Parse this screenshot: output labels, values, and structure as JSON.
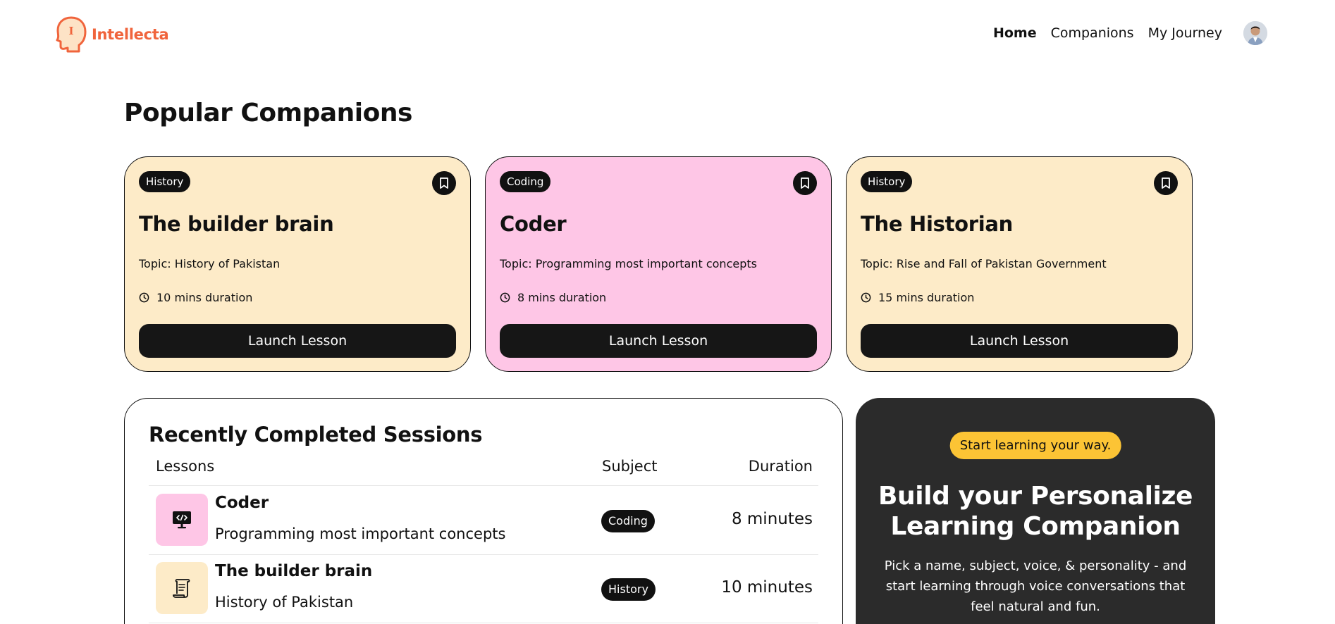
{
  "nav": {
    "brand": "Intellecta",
    "logo_letter": "I",
    "links": [
      "Home",
      "Companions",
      "My Journey"
    ],
    "active": "Home"
  },
  "popular": {
    "title": "Popular Companions",
    "cards": [
      {
        "subject": "History",
        "name": "The builder brain",
        "topic": "Topic: History of Pakistan",
        "duration": "10 mins duration",
        "button": "Launch Lesson",
        "color": "#fdebc8"
      },
      {
        "subject": "Coding",
        "name": "Coder",
        "topic": "Topic: Programming most important concepts",
        "duration": "8 mins duration",
        "button": "Launch Lesson",
        "color": "#fec6e6"
      },
      {
        "subject": "History",
        "name": "The Historian",
        "topic": "Topic: Rise and Fall of Pakistan Government",
        "duration": "15 mins duration",
        "button": "Launch Lesson",
        "color": "#fdebc8"
      }
    ]
  },
  "sessions": {
    "title": "Recently Completed Sessions",
    "columns": [
      "Lessons",
      "Subject",
      "Duration"
    ],
    "rows": [
      {
        "name": "Coder",
        "topic": "Programming most important concepts",
        "subject": "Coding",
        "duration": "8 minutes",
        "icon": "code-monitor-icon",
        "color": "#fec6e6"
      },
      {
        "name": "The builder brain",
        "topic": "History of Pakistan",
        "subject": "History",
        "duration": "10 minutes",
        "icon": "scroll-icon",
        "color": "#fdebc8"
      }
    ]
  },
  "cta": {
    "pill": "Start learning your way.",
    "title": "Build your Personalize Learning Companion",
    "description": "Pick a name, subject, voice, & personality - and start learning through voice conversations that feel natural and fun."
  },
  "colors": {
    "accent": "#f0643c",
    "dark": "#161616",
    "yellow": "#fcc435"
  }
}
